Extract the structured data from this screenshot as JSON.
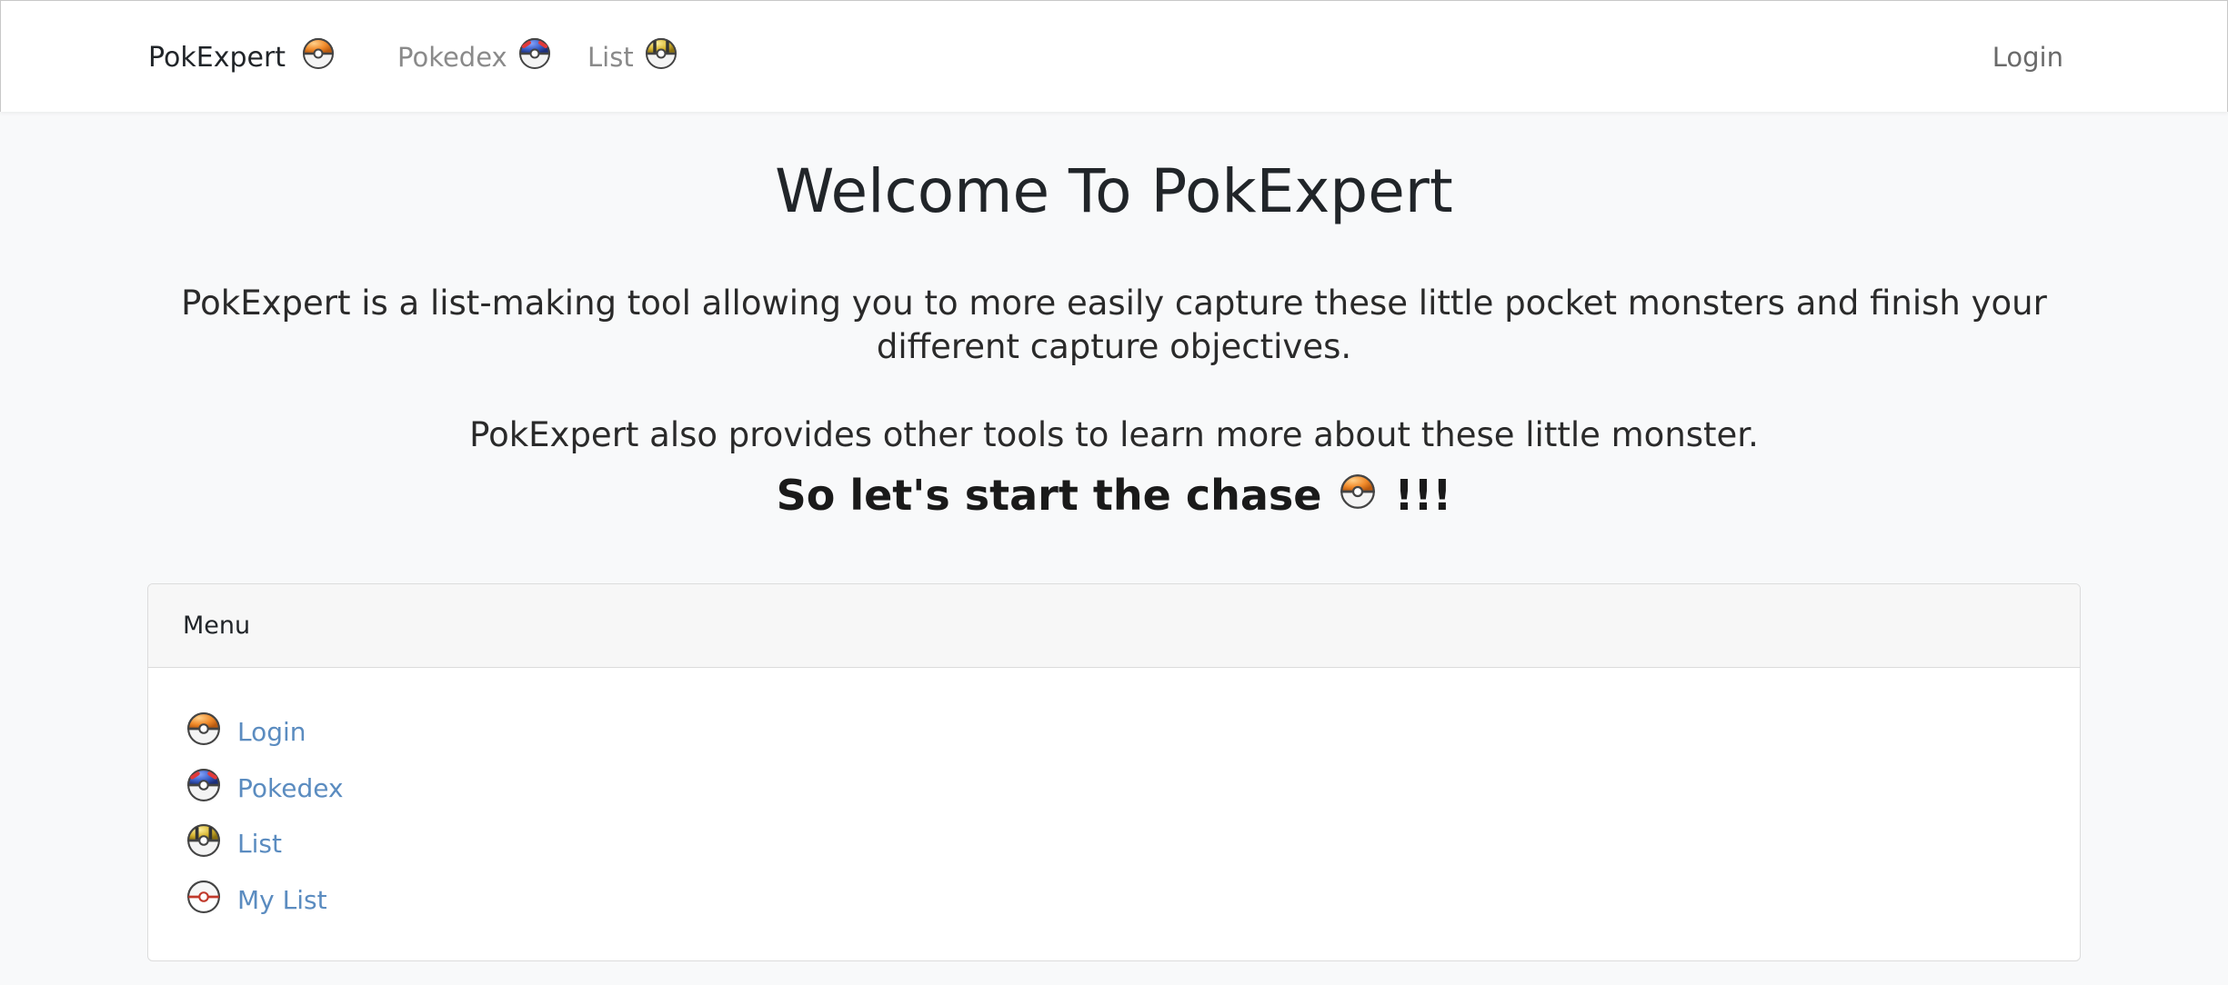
{
  "navbar": {
    "brand": "PokExpert",
    "links": [
      {
        "label": "Pokedex",
        "icon": "great-ball-icon"
      },
      {
        "label": "List",
        "icon": "ultra-ball-icon"
      }
    ],
    "login": "Login"
  },
  "hero": {
    "title": "Welcome To PokExpert",
    "paragraph1": "PokExpert is a list-making tool allowing you to more easily capture these little pocket monsters and finish your different capture objectives.",
    "paragraph2": "PokExpert also provides other tools to learn more about these little monster.",
    "chase_text": "So let's start the chase",
    "chase_suffix": "!!!"
  },
  "menu": {
    "header": "Menu",
    "items": [
      {
        "label": "Login",
        "icon": "poke-ball-icon"
      },
      {
        "label": "Pokedex",
        "icon": "great-ball-icon"
      },
      {
        "label": "List",
        "icon": "ultra-ball-icon"
      },
      {
        "label": "My List",
        "icon": "premier-ball-icon"
      }
    ]
  },
  "colors": {
    "background": "#f8f9fa",
    "link": "#5b8cc0",
    "nav_link": "#8a8a8a",
    "pokeball_top": "#f08a2a",
    "greatball_top": "#3a5fc8",
    "ultraball_top": "#d8b630",
    "premier_top": "#ffffff"
  }
}
